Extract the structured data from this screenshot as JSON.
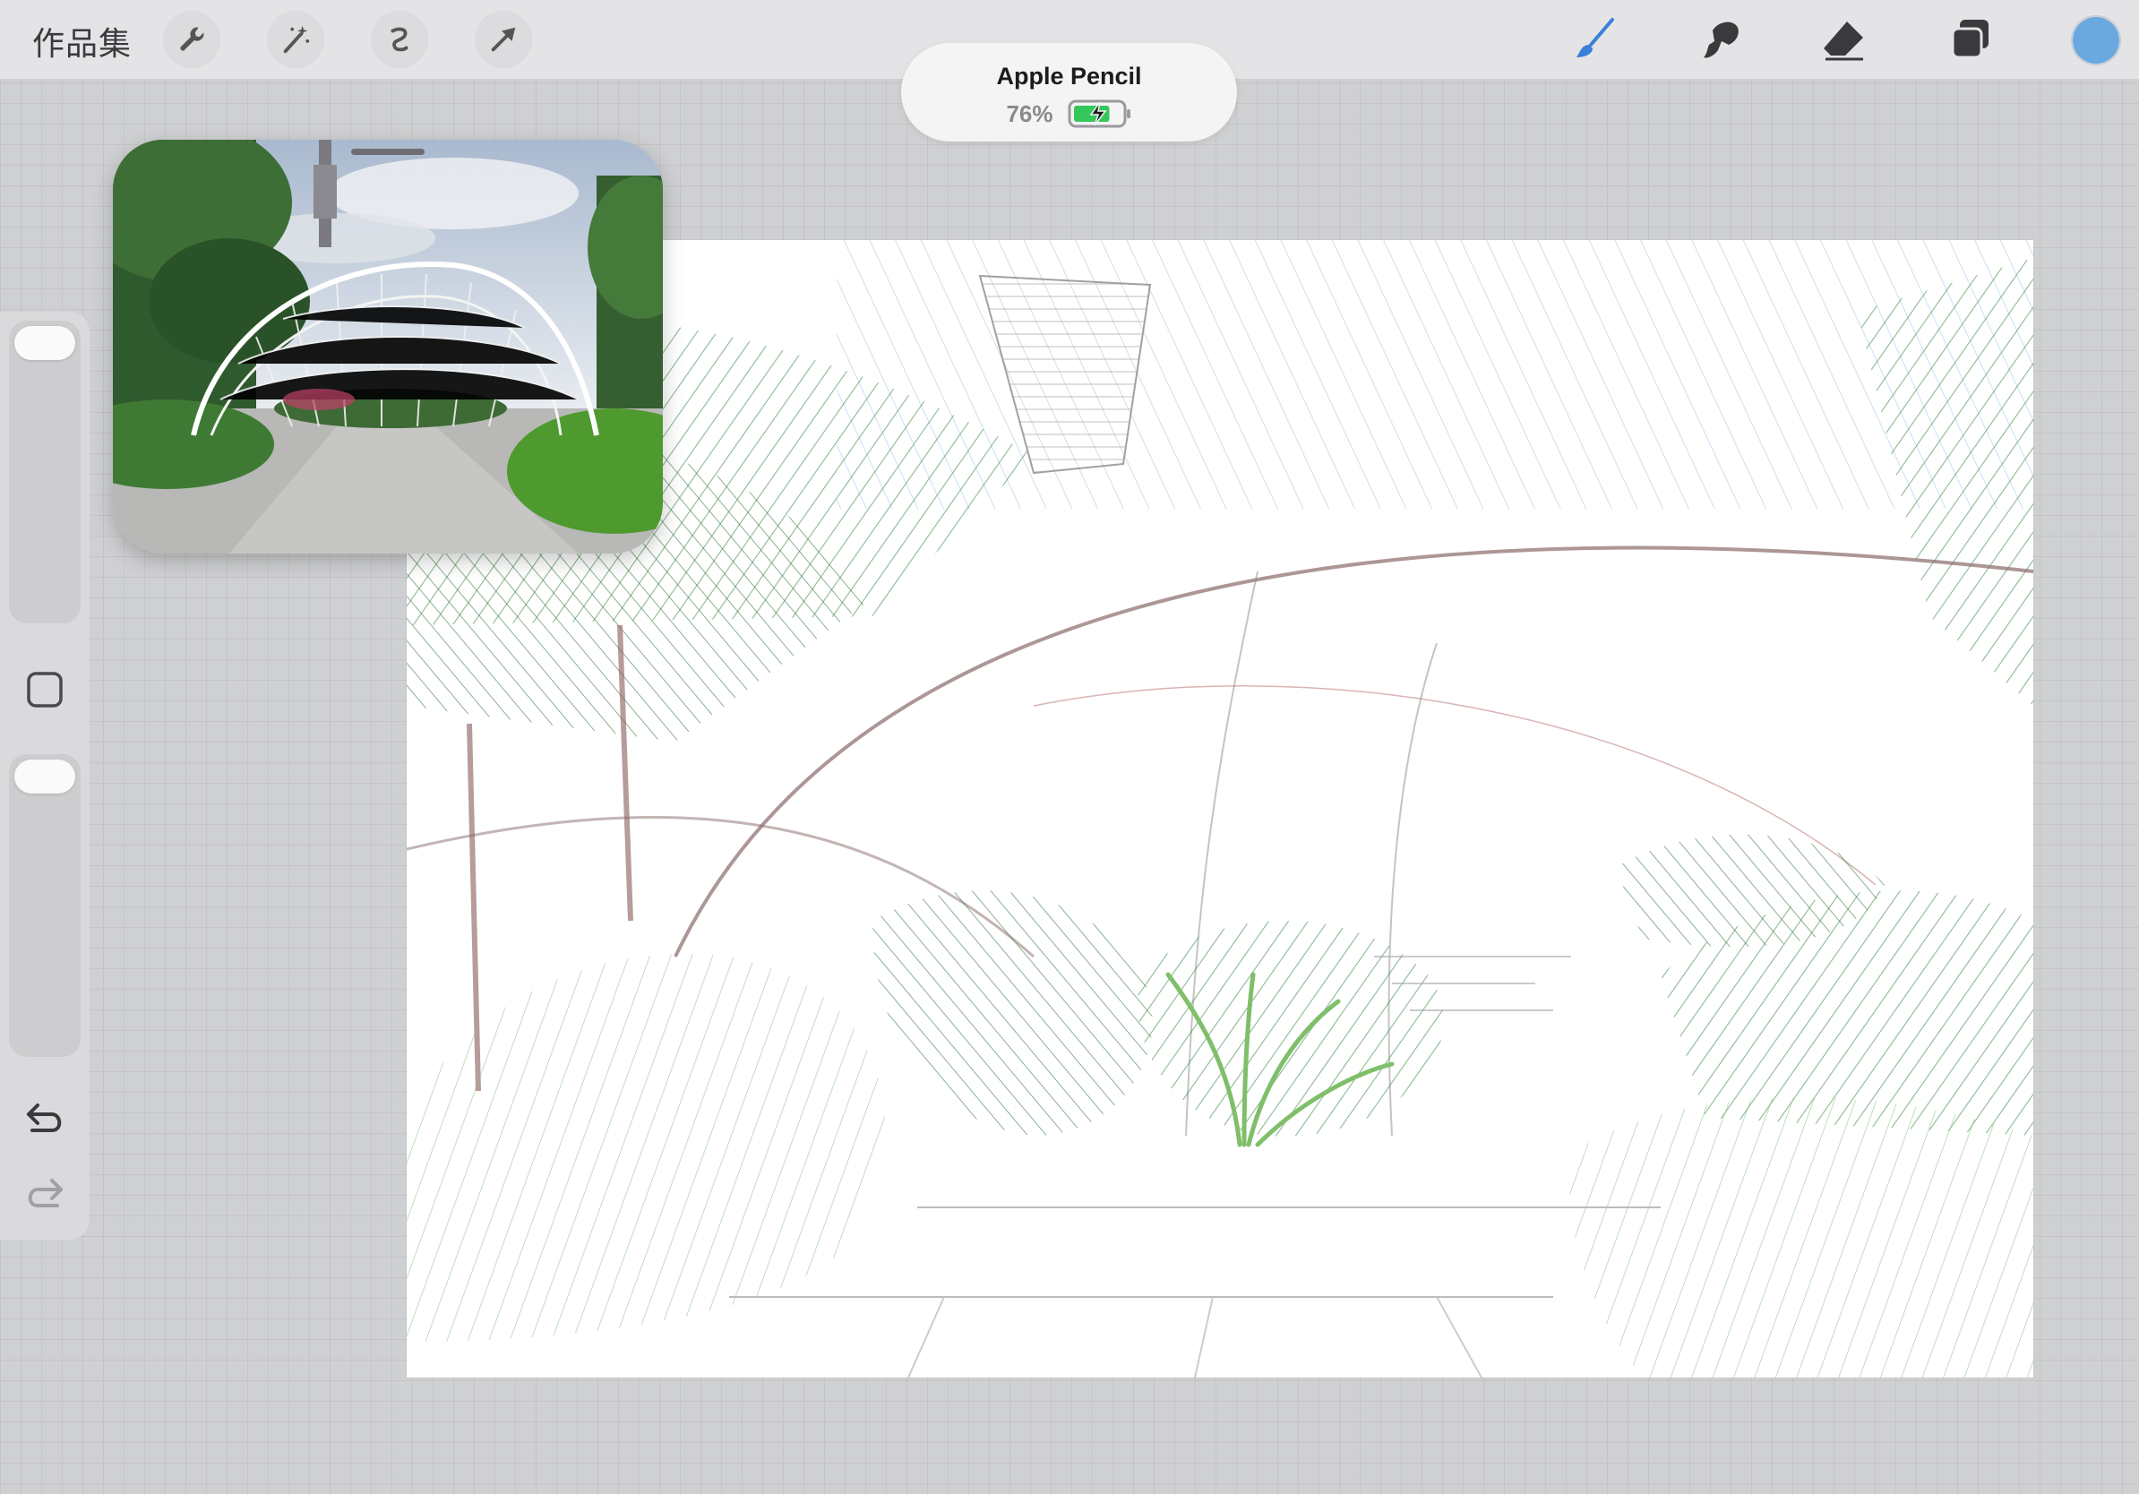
{
  "toolbar": {
    "gallery_label": "作品集",
    "left_tools": [
      "wrench-icon",
      "magic-wand-icon",
      "selection-icon",
      "transform-arrow-icon"
    ],
    "right_tools": [
      "brush-icon",
      "smudge-icon",
      "eraser-icon",
      "layers-icon"
    ],
    "active_tool": "brush-icon",
    "current_color": "#6aa8e0"
  },
  "pencil_notice": {
    "device_name": "Apple Pencil",
    "battery_percent": "76%",
    "battery_level": 0.76,
    "charging": true
  },
  "sidebar": {
    "brush_size_level": 1.0,
    "opacity_level": 1.0,
    "controls": [
      "modify-square-icon",
      "undo-icon",
      "redo-icon"
    ]
  },
  "reference_window": {
    "content": "photo-of-white-lattice-garden-arch"
  },
  "canvas": {
    "content": "pencil-sketch-of-garden-arch"
  }
}
